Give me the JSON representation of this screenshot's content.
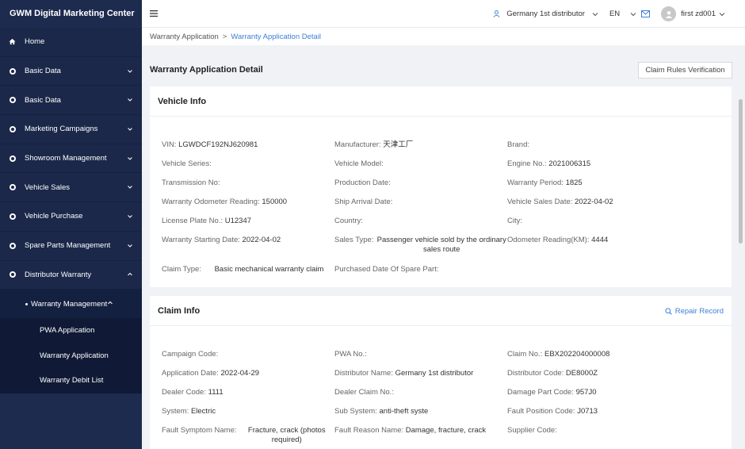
{
  "app": {
    "title": "GWM Digital Marketing Center"
  },
  "sidebar": {
    "items": [
      {
        "label": "Home",
        "icon": "home-icon",
        "expandable": false
      },
      {
        "label": "Basic Data",
        "icon": "circle-icon",
        "expandable": true
      },
      {
        "label": "Basic Data",
        "icon": "circle-icon",
        "expandable": true
      },
      {
        "label": "Marketing Campaigns",
        "icon": "circle-icon",
        "expandable": true
      },
      {
        "label": "Showroom Management",
        "icon": "circle-icon",
        "expandable": true
      },
      {
        "label": "Vehicle Sales",
        "icon": "circle-icon",
        "expandable": true
      },
      {
        "label": "Vehicle Purchase",
        "icon": "circle-icon",
        "expandable": true
      },
      {
        "label": "Spare Parts Management",
        "icon": "circle-icon",
        "expandable": true
      },
      {
        "label": "Distributor Warranty",
        "icon": "circle-icon",
        "expandable": true,
        "expanded": true
      }
    ],
    "submenu": {
      "label": "Warranty Management",
      "children": [
        "PWA Application",
        "Warranty Application",
        "Warranty Debit List"
      ]
    }
  },
  "header": {
    "distributor": "Germany 1st distributor",
    "language": "EN",
    "user": "first zd001"
  },
  "breadcrumb": {
    "parent": "Warranty Application",
    "separator": ">",
    "current": "Warranty Application Detail"
  },
  "page": {
    "title": "Warranty Application Detail",
    "rules_button": "Claim Rules Verification"
  },
  "vehicle_info": {
    "title": "Vehicle Info",
    "rows": [
      [
        {
          "label": "VIN:",
          "value": "LGWDCF192NJ620981"
        },
        {
          "label": "Manufacturer:",
          "value": "天津工厂"
        },
        {
          "label": "Brand:",
          "value": ""
        }
      ],
      [
        {
          "label": "Vehicle Series:",
          "value": ""
        },
        {
          "label": "Vehicle Model:",
          "value": ""
        },
        {
          "label": "Engine No.:",
          "value": "2021006315"
        }
      ],
      [
        {
          "label": "Transmission No:",
          "value": ""
        },
        {
          "label": "Production Date:",
          "value": ""
        },
        {
          "label": "Warranty Period:",
          "value": "1825"
        }
      ],
      [
        {
          "label": "Warranty Odometer Reading:",
          "value": "150000"
        },
        {
          "label": "Ship Arrival Date:",
          "value": ""
        },
        {
          "label": "Vehicle Sales Date:",
          "value": "2022-04-02"
        }
      ],
      [
        {
          "label": "License Plate No.:",
          "value": "U12347"
        },
        {
          "label": "Country:",
          "value": ""
        },
        {
          "label": "City:",
          "value": ""
        }
      ],
      [
        {
          "label": "Warranty Starting Date:",
          "value": "2022-04-02"
        },
        {
          "label": "Sales Type:",
          "value": "Passenger vehicle sold by the ordinary sales route"
        },
        {
          "label": "Odometer Reading(KM):",
          "value": "4444"
        }
      ],
      [
        {
          "label": "Claim Type:",
          "value": "Basic mechanical warranty claim"
        },
        {
          "label": "Purchased Date Of Spare Part:",
          "value": ""
        }
      ]
    ]
  },
  "claim_info": {
    "title": "Claim Info",
    "repair_link": "Repair Record",
    "rows": [
      [
        {
          "label": "Campaign Code:",
          "value": ""
        },
        {
          "label": "PWA No.:",
          "value": ""
        },
        {
          "label": "Claim No.:",
          "value": "EBX202204000008"
        }
      ],
      [
        {
          "label": "Application Date:",
          "value": "2022-04-29"
        },
        {
          "label": "Distributor Name:",
          "value": "Germany 1st distributor"
        },
        {
          "label": "Distributor Code:",
          "value": "DE8000Z"
        }
      ],
      [
        {
          "label": "Dealer Code:",
          "value": "1111"
        },
        {
          "label": "Dealer Claim No.:",
          "value": ""
        },
        {
          "label": "Damage Part Code:",
          "value": "957J0"
        }
      ],
      [
        {
          "label": "System:",
          "value": "Electric"
        },
        {
          "label": "Sub System:",
          "value": "anti-theft syste"
        },
        {
          "label": "Fault Position Code:",
          "value": "J0713"
        }
      ],
      [
        {
          "label": "Fault Symptom Name:",
          "value": "Fracture, crack (photos required)"
        },
        {
          "label": "Fault Reason Name:",
          "value": "Damage, fracture, crack"
        },
        {
          "label": "Supplier Code:",
          "value": ""
        }
      ]
    ]
  },
  "colors": {
    "sidebar_bg": "#1d2b4f",
    "link": "#3d7fd9"
  }
}
